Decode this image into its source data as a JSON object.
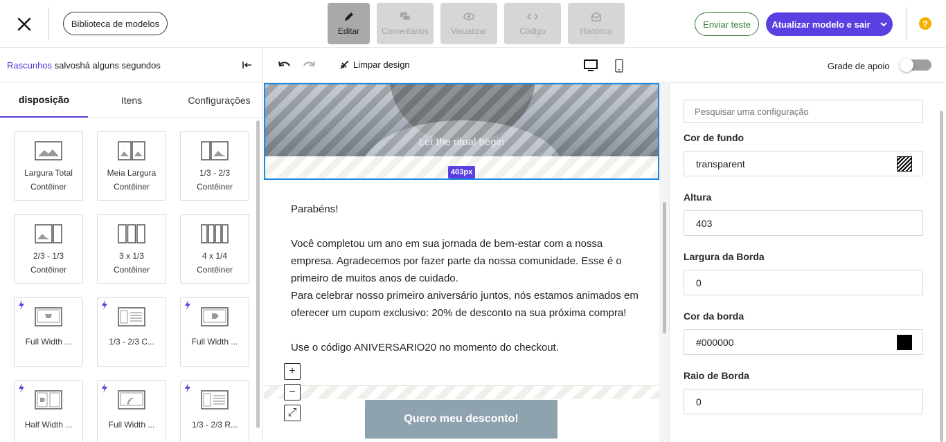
{
  "topbar": {
    "library_label": "Biblioteca de modelos",
    "modes": [
      {
        "name": "edit",
        "label": "Editar",
        "icon": "pencil-icon"
      },
      {
        "name": "comments",
        "label": "Comentários",
        "icon": "comments-icon"
      },
      {
        "name": "preview",
        "label": "Visualizar",
        "icon": "eye-icon"
      },
      {
        "name": "code",
        "label": "Código",
        "icon": "code-icon"
      },
      {
        "name": "history",
        "label": "Histórico",
        "icon": "envelope-icon"
      }
    ],
    "send_test_label": "Enviar teste",
    "update_label": "Atualizar modelo e sair",
    "help_glyph": "?"
  },
  "left": {
    "draft_link": "Rascunhos",
    "draft_status": " salvoshá alguns segundos",
    "tabs": [
      "disposição",
      "Itens",
      "Configurações"
    ],
    "layouts": [
      {
        "label": "Largura Total\nContêiner",
        "type": "full",
        "bolt": false
      },
      {
        "label": "Meia Largura\nContêiner",
        "type": "half",
        "bolt": false
      },
      {
        "label": "1/3 - 2/3\nContêiner",
        "type": "third-two",
        "bolt": false
      },
      {
        "label": "2/3 - 1/3\nContêiner",
        "type": "two-third",
        "bolt": false
      },
      {
        "label": "3 x 1/3\nContêiner",
        "type": "three",
        "bolt": false
      },
      {
        "label": "4 x 1/4\nContêiner",
        "type": "four",
        "bolt": false
      },
      {
        "label": "Full Width ...",
        "type": "full-cart",
        "bolt": true
      },
      {
        "label": "1/3 - 2/3 C...",
        "type": "third-text",
        "bolt": true
      },
      {
        "label": "Full Width ...",
        "type": "full-tag",
        "bolt": true
      },
      {
        "label": "Half Width ...",
        "type": "half-tag",
        "bolt": true
      },
      {
        "label": "Full Width ...",
        "type": "full-rss",
        "bolt": true
      },
      {
        "label": "1/3 - 2/3 R...",
        "type": "third-rss",
        "bolt": true
      }
    ]
  },
  "toolbar": {
    "clear_label": "Limpar design",
    "grid_label": "Grade de apoio",
    "grid_enabled": false
  },
  "canvas": {
    "hero_text": "Let the ritual begin",
    "height_badge": "403px",
    "paragraphs": [
      "Parabéns!",
      "",
      "Você completou um ano em sua jornada de bem-estar com a nossa empresa. Agradecemos por fazer parte da nossa comunidade. Esse é o primeiro de muitos anos de cuidado.",
      "Para celebrar nosso primeiro aniversário juntos, nós estamos animados em oferecer um cupom exclusivo: 20% de desconto na sua próxima compra!",
      "",
      "Use o código ANIVERSARIO20 no momento do checkout."
    ],
    "cta_label": "Quero meu desconto!",
    "zoom_in": "+",
    "zoom_out": "−",
    "fit": "⤢"
  },
  "settings": {
    "search_placeholder": "Pesquisar uma configuração",
    "fields": [
      {
        "label": "Cor de fundo",
        "value": "transparent",
        "swatch": "hatch"
      },
      {
        "label": "Altura",
        "value": "403",
        "swatch": ""
      },
      {
        "label": "Largura da Borda",
        "value": "0",
        "swatch": ""
      },
      {
        "label": "Cor da borda",
        "value": "#000000",
        "swatch": "black"
      },
      {
        "label": "Raio de Borda",
        "value": "0",
        "swatch": ""
      }
    ]
  },
  "colors": {
    "accent": "#5b3fe0",
    "success": "#2e7d32",
    "selection": "#1e88e5",
    "cta": "#8fa3af",
    "help": "#f5b000"
  }
}
